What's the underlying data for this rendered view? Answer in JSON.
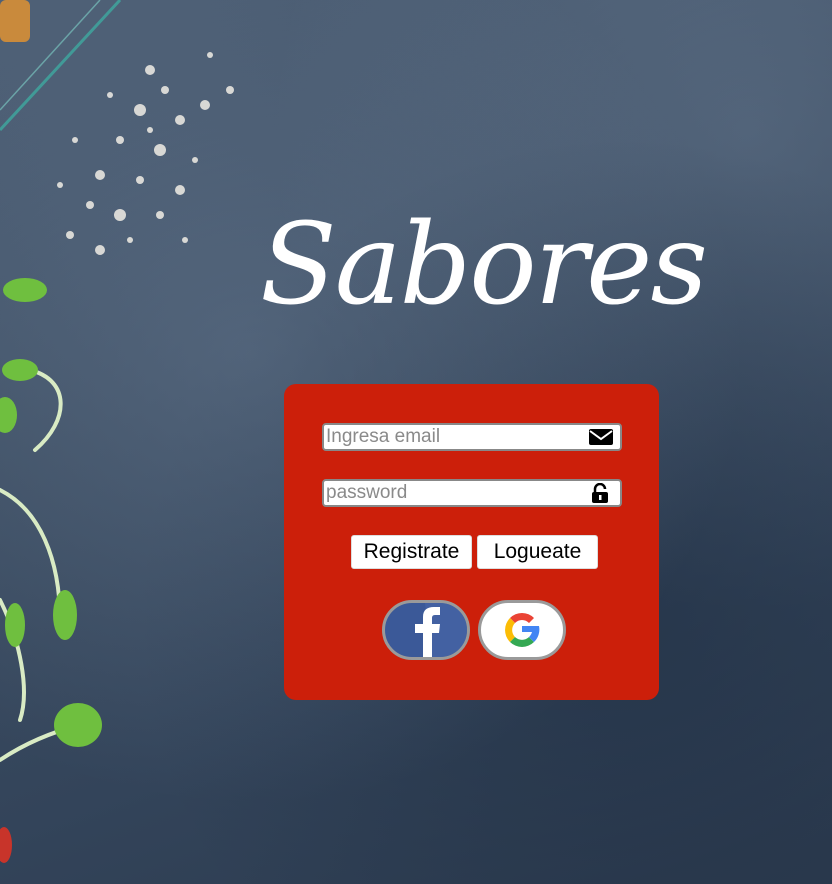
{
  "logo": {
    "text": "Sabores"
  },
  "login_form": {
    "email": {
      "placeholder": "Ingresa email",
      "value": "",
      "icon": "envelope-icon"
    },
    "password": {
      "placeholder": "password",
      "value": "",
      "icon": "unlock-icon"
    },
    "register_label": "Registrate",
    "login_label": "Logueate",
    "social": [
      {
        "provider": "facebook",
        "icon": "facebook-icon"
      },
      {
        "provider": "google",
        "icon": "google-icon"
      }
    ]
  },
  "colors": {
    "card": "#cc1f0a",
    "background": "#3c4d62",
    "facebook": "#3b5998",
    "logo": "#ffffff"
  }
}
